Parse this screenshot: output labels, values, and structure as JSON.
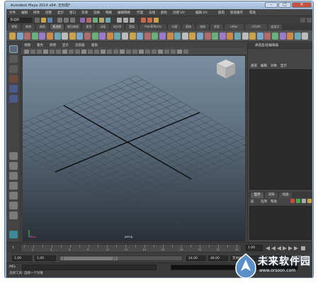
{
  "window": {
    "title": "Autodesk Maya 2014 x64: 无标题*",
    "minimize": "–",
    "maximize": "□",
    "close": "✕"
  },
  "menubar": [
    "文件",
    "编辑",
    "修改",
    "创建",
    "显示",
    "窗口",
    "资源",
    "选择",
    "网格",
    "编辑网格",
    "代理",
    "法线",
    "颜色",
    "创建 UV",
    "编辑 UV",
    "肌肉",
    "管道缓存",
    "帮助"
  ],
  "statusline": {
    "mode": "多边形"
  },
  "shelf_tabs": [
    "常规",
    "曲线",
    "曲面",
    "多边形",
    "细分曲面",
    "变形",
    "动画",
    "动力学",
    "渲染",
    "PaintEffects",
    "卡通",
    "肌肉",
    "流体",
    "毛发",
    "nHair",
    "nCloth",
    "自定义"
  ],
  "shelf_active_index": 3,
  "panel_menu": [
    "视图",
    "着色",
    "照明",
    "显示",
    "渲染器",
    "面板"
  ],
  "viewport": {
    "camera": "persp"
  },
  "channel_box": {
    "header": "通道盒/层编辑器",
    "menu": [
      "通道",
      "编辑",
      "对象",
      "显示"
    ]
  },
  "layer_editor": {
    "tabs": [
      "显示",
      "渲染",
      "动画"
    ],
    "active_index": 0,
    "menu": [
      "层",
      "选项",
      "帮助"
    ]
  },
  "time_slider": {
    "start_frame": "1",
    "current_frame": "1.00",
    "ticks": [
      "2",
      "4",
      "6",
      "8",
      "10",
      "12",
      "14",
      "16",
      "18",
      "20",
      "22",
      "24"
    ]
  },
  "range_slider": {
    "start": "1.00",
    "playback_start": "1.00",
    "handle_start": "1",
    "handle_end": "24",
    "playback_end": "24.00",
    "end": "48.00",
    "anim_layer": "无动画层",
    "char_set": "无角色集"
  },
  "command_line": {
    "label": "MEL"
  },
  "help_line": "选择工具: 选择一个对象",
  "watermark": {
    "text": "未来软件园",
    "url": "www.orsoon.com"
  },
  "colors": {
    "accent": "#5a8fc9",
    "window_frame": "#9bb7d2",
    "app_bg": "#444444"
  }
}
